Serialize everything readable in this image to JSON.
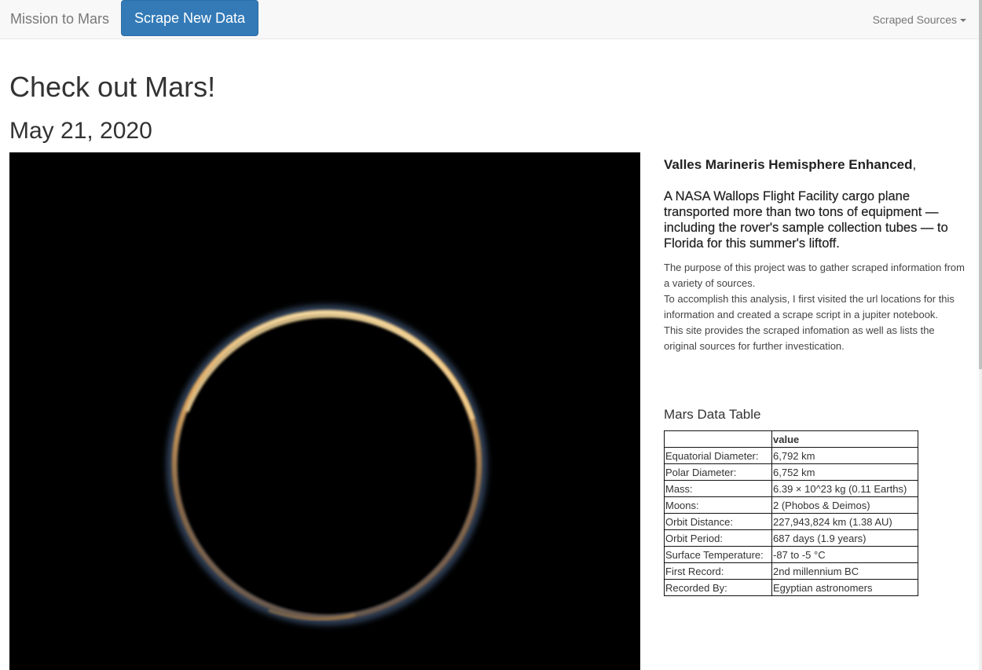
{
  "navbar": {
    "brand": "Mission to Mars",
    "scrape_button": "Scrape New Data",
    "dropdown_label": "Scraped Sources"
  },
  "main": {
    "title": "Check out Mars!",
    "date": "May 21, 2020"
  },
  "news": {
    "title": "Valles Marineris Hemisphere Enhanced",
    "title_suffix": ",",
    "paragraph": "A NASA Wallops Flight Facility cargo plane transported more than two tons of equipment — including the rover's sample collection tubes — to Florida for this summer's liftoff.",
    "description_lines": [
      "The purpose of this project was to gather scraped information from a variety of sources.",
      "To accomplish this analysis, I first visited the url locations for this information and created a scrape script in a jupiter notebook.",
      "This site provides the scraped infomation as well as lists the original sources for further investication."
    ]
  },
  "table": {
    "title": "Mars Data Table",
    "header": [
      "",
      "value"
    ],
    "rows": [
      [
        "Equatorial Diameter:",
        "6,792 km"
      ],
      [
        "Polar Diameter:",
        "6,752 km"
      ],
      [
        "Mass:",
        "6.39 × 10^23 kg (0.11 Earths)"
      ],
      [
        "Moons:",
        "2 (Phobos & Deimos)"
      ],
      [
        "Orbit Distance:",
        "227,943,824 km (1.38 AU)"
      ],
      [
        "Orbit Period:",
        "687 days (1.9 years)"
      ],
      [
        "Surface Temperature:",
        "-87 to -5 °C"
      ],
      [
        "First Record:",
        "2nd millennium BC"
      ],
      [
        "Recorded By:",
        "Egyptian astronomers"
      ]
    ]
  },
  "colors": {
    "primary_button": "#337ab7",
    "navbar_bg": "#f8f8f8",
    "image_bg": "#000000"
  },
  "icons": {
    "dropdown_caret": "caret-down-icon"
  }
}
